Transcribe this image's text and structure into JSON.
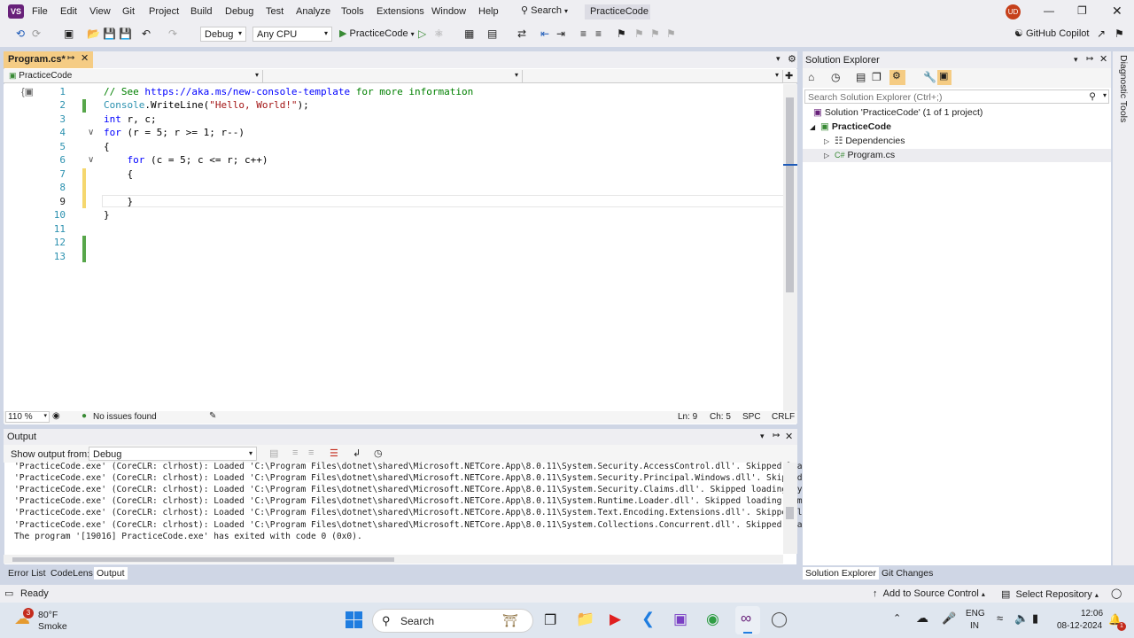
{
  "app": {
    "logo": "VS",
    "menu": [
      "File",
      "Edit",
      "View",
      "Git",
      "Project",
      "Build",
      "Debug",
      "Test",
      "Analyze",
      "Tools",
      "Extensions",
      "Window",
      "Help"
    ],
    "search_label": "Search",
    "solution_title": "PracticeCode",
    "user_initials": "UD"
  },
  "toolbar": {
    "config": "Debug",
    "platform": "Any CPU",
    "run_target": "PracticeCode",
    "copilot": "GitHub Copilot"
  },
  "document": {
    "tab_title": "Program.cs*",
    "nav_project": "PracticeCode",
    "nav_type": "",
    "nav_member": ""
  },
  "editor": {
    "lines": [
      {
        "n": "1",
        "text": "// See https://aka.ms/new-console-template for more information"
      },
      {
        "n": "2",
        "text": "Console.WriteLine(\"Hello, World!\");"
      },
      {
        "n": "3",
        "text": "int r, c;"
      },
      {
        "n": "4",
        "text": "for (r = 5; r >= 1; r--)"
      },
      {
        "n": "5",
        "text": "{"
      },
      {
        "n": "6",
        "text": "    for (c = 5; c <= r; c++)"
      },
      {
        "n": "7",
        "text": "    {"
      },
      {
        "n": "8",
        "text": ""
      },
      {
        "n": "9",
        "text": "    }"
      },
      {
        "n": "10",
        "text": "}"
      },
      {
        "n": "11",
        "text": ""
      },
      {
        "n": "12",
        "text": ""
      },
      {
        "n": "13",
        "text": ""
      }
    ],
    "zoom": "110 %",
    "issues": "No issues found",
    "ln": "Ln: 9",
    "ch": "Ch: 5",
    "spc": "SPC",
    "crlf": "CRLF"
  },
  "output": {
    "title": "Output",
    "show_from_label": "Show output from:",
    "show_from_value": "Debug",
    "lines": [
      "'PracticeCode.exe' (CoreCLR: clrhost): Loaded 'C:\\Program Files\\dotnet\\shared\\Microsoft.NETCore.App\\8.0.11\\System.Security.AccessControl.dll'. Skipped loading symb",
      "'PracticeCode.exe' (CoreCLR: clrhost): Loaded 'C:\\Program Files\\dotnet\\shared\\Microsoft.NETCore.App\\8.0.11\\System.Security.Principal.Windows.dll'. Skipped loading",
      "'PracticeCode.exe' (CoreCLR: clrhost): Loaded 'C:\\Program Files\\dotnet\\shared\\Microsoft.NETCore.App\\8.0.11\\System.Security.Claims.dll'. Skipped loading symbols. Mc",
      "'PracticeCode.exe' (CoreCLR: clrhost): Loaded 'C:\\Program Files\\dotnet\\shared\\Microsoft.NETCore.App\\8.0.11\\System.Runtime.Loader.dll'. Skipped loading symbols. Mod",
      "'PracticeCode.exe' (CoreCLR: clrhost): Loaded 'C:\\Program Files\\dotnet\\shared\\Microsoft.NETCore.App\\8.0.11\\System.Text.Encoding.Extensions.dll'. Skipped loading sy",
      "'PracticeCode.exe' (CoreCLR: clrhost): Loaded 'C:\\Program Files\\dotnet\\shared\\Microsoft.NETCore.App\\8.0.11\\System.Collections.Concurrent.dll'. Skipped loading symb",
      "The program '[19016] PracticeCode.exe' has exited with code 0 (0x0)."
    ]
  },
  "bottom_tabs": [
    "Error List",
    "CodeLens",
    "Output"
  ],
  "solution_explorer": {
    "title": "Solution Explorer",
    "search_placeholder": "Search Solution Explorer (Ctrl+;)",
    "solution": "Solution 'PracticeCode' (1 of 1 project)",
    "project": "PracticeCode",
    "dependencies": "Dependencies",
    "file": "Program.cs",
    "file_icon": "C#",
    "tabs": [
      "Solution Explorer",
      "Git Changes"
    ]
  },
  "right_rail": "Diagnostic Tools",
  "status": {
    "ready": "Ready",
    "source_control": "Add to Source Control",
    "repository": "Select Repository"
  },
  "taskbar": {
    "weather_temp": "80°F",
    "weather_desc": "Smoke",
    "weather_badge": "3",
    "search": "Search",
    "lang1": "ENG",
    "lang2": "IN",
    "time": "12:06",
    "date": "08-12-2024",
    "notif": "1"
  },
  "colors": {
    "accent": "#68217a",
    "tab_active": "#f5cc84",
    "keyword": "#0000ff",
    "comment": "#008000",
    "string": "#a31515",
    "type": "#2b91af"
  }
}
